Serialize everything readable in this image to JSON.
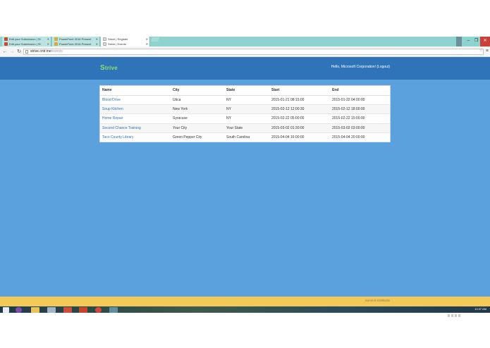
{
  "browser": {
    "tabs_row1": [
      {
        "title": "Edit your Submission | St",
        "favicon": "#c84b31",
        "active": false
      },
      {
        "title": "PowerPoint 2016 Present",
        "favicon": "#d9a93a",
        "active": false
      },
      {
        "title": "Strive | Register",
        "favicon": "#dddddd",
        "active": true
      }
    ],
    "tabs_row2": [
      {
        "title": "Edit your Submission | St",
        "favicon": "#c84b31",
        "active": false
      },
      {
        "title": "PowerPoint 2016 Present",
        "favicon": "#d9a93a",
        "active": false
      },
      {
        "title": "Strive | Events",
        "favicon": "#dddddd",
        "active": true
      }
    ],
    "url_host": "strive.cntr.me",
    "url_path": "/events",
    "back_icon": "back-arrow-icon",
    "forward_icon": "forward-arrow-icon",
    "reload_icon": "reload-icon"
  },
  "app": {
    "logo_mark": "S",
    "logo_rest": "trive",
    "brand_color": "#8fe06a",
    "greeting": "Hello, Microsoft Corporation! (Logout)"
  },
  "events_table": {
    "headers": [
      "Name",
      "City",
      "State",
      "Start",
      "End"
    ],
    "rows": [
      [
        "Blood Drive",
        "Utica",
        "NY",
        "2015-01-21 08:15:00",
        "2015-01-22 04:00:00"
      ],
      [
        "Soup Kitchen",
        "New York",
        "NY",
        "2015-02-12 12:00:30",
        "2015-02-12 18:00:00"
      ],
      [
        "Home Repair",
        "Syracuse",
        "NY",
        "2015-02-22 05:00:00",
        "2015-02-22 15:00:00"
      ],
      [
        "Second Chance Training",
        "Your City",
        "Your State",
        "2015-03-02 01:30:00",
        "2015-03-02 03:00:00"
      ],
      [
        "Taco County Library",
        "Green Pepper City",
        "South Carolina",
        "2015-04-04 16:00:00",
        "2015-04-04 20:00:00"
      ]
    ]
  },
  "footer": {
    "text": "Summit 818/Bolts"
  },
  "taskbar": {
    "clock": "10:37 AM"
  }
}
